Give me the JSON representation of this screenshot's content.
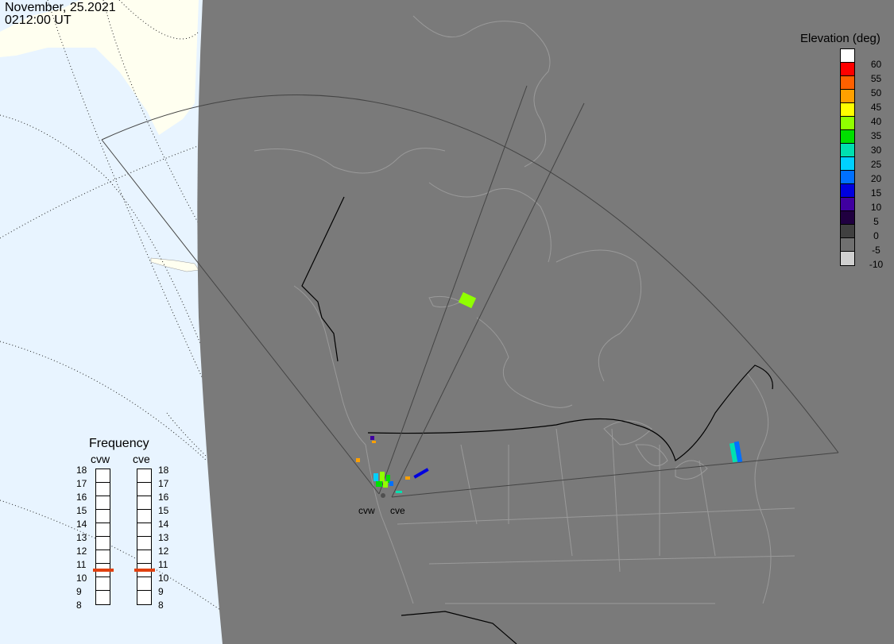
{
  "header": {
    "date": "November, 25.2021",
    "time": "0212:00 UT"
  },
  "legend": {
    "title": "Elevation (deg)",
    "labels": [
      "60",
      "55",
      "50",
      "45",
      "40",
      "35",
      "30",
      "25",
      "20",
      "15",
      "10",
      "5",
      "0",
      "-5",
      "-10"
    ],
    "colors": [
      "#ffffff",
      "#ff0000",
      "#ff6000",
      "#ffa000",
      "#ffff00",
      "#90ff00",
      "#00e000",
      "#00e0b0",
      "#00d0ff",
      "#0070ff",
      "#0000e0",
      "#4000a0",
      "#200040",
      "#404040",
      "#707070",
      "#d0d0d0"
    ]
  },
  "frequency": {
    "title": "Frequency",
    "radars": [
      "cvw",
      "cve"
    ],
    "ticks": [
      "18",
      "17",
      "16",
      "15",
      "14",
      "13",
      "12",
      "11",
      "10",
      "9",
      "8"
    ],
    "selected_mhz": {
      "cvw": 10.5,
      "cve": 10.5
    }
  },
  "sites": {
    "cvw": "cvw",
    "cve": "cve"
  },
  "colors": {
    "land": "#7a7a7a",
    "ocean": "#e8f4ff",
    "ice": "#fffff0",
    "coast": "#a0a0a0",
    "border": "#000000",
    "marker": "#e04010"
  }
}
